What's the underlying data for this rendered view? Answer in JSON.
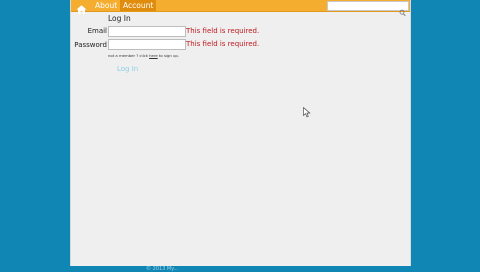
{
  "nav": {
    "about_label": "About",
    "account_label": "Account",
    "search_value": ""
  },
  "form": {
    "title": "Log In",
    "email_label": "Email",
    "password_label": "Password",
    "email_value": "",
    "password_value": "",
    "email_error": "This field is required.",
    "password_error": "This field is required.",
    "hint_prefix": "not a member ? click",
    "hint_link": "here",
    "hint_suffix": "to sign up.",
    "submit_label": "Log In"
  },
  "footer": {
    "text": "© 2013 My..."
  },
  "icons": {
    "home": "home-icon",
    "search": "search-icon",
    "cursor": "cursor-arrow"
  },
  "colors": {
    "background": "#0f86b4",
    "nav": "#f5ad2f",
    "nav_active": "#e08d0e",
    "error": "#c0191f",
    "link": "#8fd0e4"
  }
}
